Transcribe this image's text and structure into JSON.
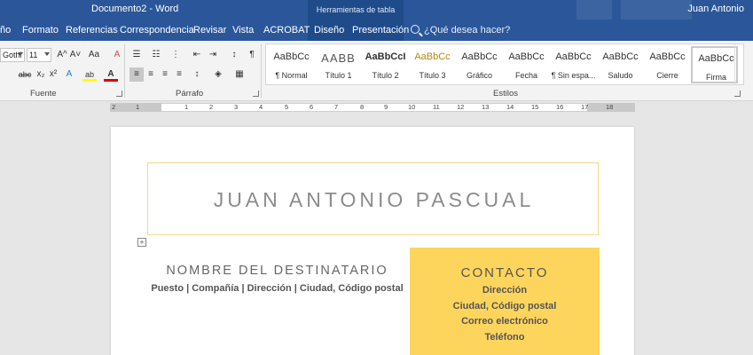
{
  "titlebar": {
    "document_title": "Documento2 - Word",
    "table_tools": "Herramientas de tabla",
    "user": "Juan Antonio"
  },
  "tabs": [
    {
      "label": "ño"
    },
    {
      "label": "Formato"
    },
    {
      "label": "Referencias"
    },
    {
      "label": "Correspondencia"
    },
    {
      "label": "Revisar"
    },
    {
      "label": "Vista"
    },
    {
      "label": "ACROBAT"
    },
    {
      "label": "Diseño"
    },
    {
      "label": "Presentación"
    }
  ],
  "search": {
    "placeholder": "¿Qué desea hacer?"
  },
  "ribbon": {
    "font_name": "Gothi",
    "font_size": "11",
    "groups": {
      "font": "Fuente",
      "paragraph": "Párrafo",
      "styles": "Estilos"
    },
    "font_buttons": {
      "grow": "A^",
      "shrink": "A˅",
      "case": "Aa",
      "clear": "A",
      "strike": "abc",
      "sub": "x₂",
      "sup": "x²",
      "text_effect": "A",
      "highlight": "ab",
      "color": "A"
    },
    "styles": [
      {
        "preview": "AaBbCc",
        "label": "¶ Normal"
      },
      {
        "preview": "AABB",
        "label": "Título 1"
      },
      {
        "preview": "AaBbCcI",
        "label": "Título 2"
      },
      {
        "preview": "AaBbCc",
        "label": "Título 3"
      },
      {
        "preview": "AaBbCc",
        "label": "Gráfico"
      },
      {
        "preview": "AaBbCc",
        "label": "Fecha"
      },
      {
        "preview": "AaBbCc",
        "label": "¶ Sin espa..."
      },
      {
        "preview": "AaBbCc",
        "label": "Saludo"
      },
      {
        "preview": "AaBbCc",
        "label": "Cierre"
      },
      {
        "preview": "AaBbCc",
        "label": "Firma"
      }
    ]
  },
  "ruler": {
    "numbers": [
      "2",
      "1",
      "1",
      "2",
      "3",
      "4",
      "5",
      "6",
      "7",
      "8",
      "9",
      "10",
      "11",
      "12",
      "13",
      "14",
      "15",
      "16",
      "17",
      "18"
    ]
  },
  "document": {
    "name": "JUAN ANTONIO PASCUAL",
    "table_handle": "+",
    "recipient_title": "NOMBRE DEL DESTINATARIO",
    "recipient_info": "Puesto | Compañía | Dirección | Ciudad, Código postal",
    "contact_title": "CONTACTO",
    "contact_lines": [
      "Dirección",
      "Ciudad, Código postal",
      "Correo electrónico",
      "Teléfono"
    ]
  },
  "colors": {
    "word_blue": "#2b579a",
    "accent_yellow": "#fdd55c"
  }
}
